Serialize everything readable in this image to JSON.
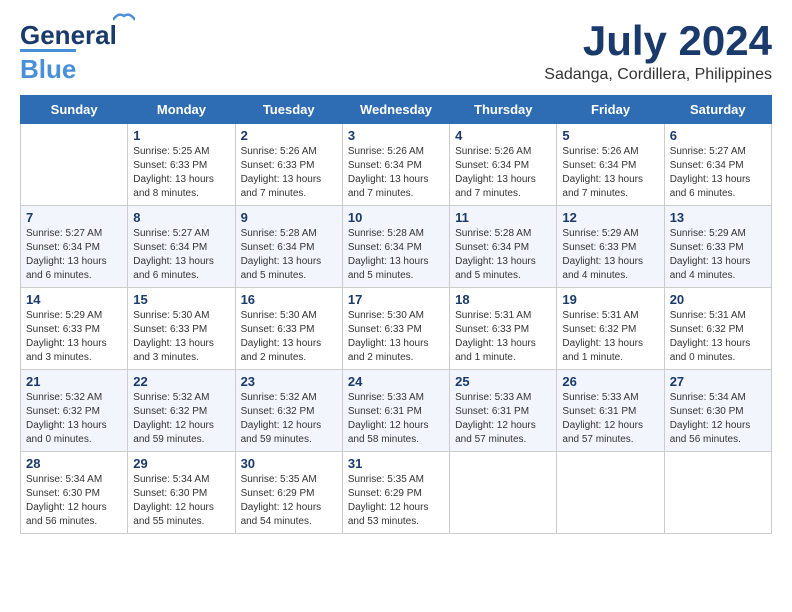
{
  "header": {
    "logo_general": "General",
    "logo_blue": "Blue",
    "month": "July 2024",
    "location": "Sadanga, Cordillera, Philippines"
  },
  "calendar": {
    "days_of_week": [
      "Sunday",
      "Monday",
      "Tuesday",
      "Wednesday",
      "Thursday",
      "Friday",
      "Saturday"
    ],
    "weeks": [
      [
        {
          "day": "",
          "info": ""
        },
        {
          "day": "1",
          "info": "Sunrise: 5:25 AM\nSunset: 6:33 PM\nDaylight: 13 hours\nand 8 minutes."
        },
        {
          "day": "2",
          "info": "Sunrise: 5:26 AM\nSunset: 6:33 PM\nDaylight: 13 hours\nand 7 minutes."
        },
        {
          "day": "3",
          "info": "Sunrise: 5:26 AM\nSunset: 6:34 PM\nDaylight: 13 hours\nand 7 minutes."
        },
        {
          "day": "4",
          "info": "Sunrise: 5:26 AM\nSunset: 6:34 PM\nDaylight: 13 hours\nand 7 minutes."
        },
        {
          "day": "5",
          "info": "Sunrise: 5:26 AM\nSunset: 6:34 PM\nDaylight: 13 hours\nand 7 minutes."
        },
        {
          "day": "6",
          "info": "Sunrise: 5:27 AM\nSunset: 6:34 PM\nDaylight: 13 hours\nand 6 minutes."
        }
      ],
      [
        {
          "day": "7",
          "info": "Sunrise: 5:27 AM\nSunset: 6:34 PM\nDaylight: 13 hours\nand 6 minutes."
        },
        {
          "day": "8",
          "info": "Sunrise: 5:27 AM\nSunset: 6:34 PM\nDaylight: 13 hours\nand 6 minutes."
        },
        {
          "day": "9",
          "info": "Sunrise: 5:28 AM\nSunset: 6:34 PM\nDaylight: 13 hours\nand 5 minutes."
        },
        {
          "day": "10",
          "info": "Sunrise: 5:28 AM\nSunset: 6:34 PM\nDaylight: 13 hours\nand 5 minutes."
        },
        {
          "day": "11",
          "info": "Sunrise: 5:28 AM\nSunset: 6:34 PM\nDaylight: 13 hours\nand 5 minutes."
        },
        {
          "day": "12",
          "info": "Sunrise: 5:29 AM\nSunset: 6:33 PM\nDaylight: 13 hours\nand 4 minutes."
        },
        {
          "day": "13",
          "info": "Sunrise: 5:29 AM\nSunset: 6:33 PM\nDaylight: 13 hours\nand 4 minutes."
        }
      ],
      [
        {
          "day": "14",
          "info": "Sunrise: 5:29 AM\nSunset: 6:33 PM\nDaylight: 13 hours\nand 3 minutes."
        },
        {
          "day": "15",
          "info": "Sunrise: 5:30 AM\nSunset: 6:33 PM\nDaylight: 13 hours\nand 3 minutes."
        },
        {
          "day": "16",
          "info": "Sunrise: 5:30 AM\nSunset: 6:33 PM\nDaylight: 13 hours\nand 2 minutes."
        },
        {
          "day": "17",
          "info": "Sunrise: 5:30 AM\nSunset: 6:33 PM\nDaylight: 13 hours\nand 2 minutes."
        },
        {
          "day": "18",
          "info": "Sunrise: 5:31 AM\nSunset: 6:33 PM\nDaylight: 13 hours\nand 1 minute."
        },
        {
          "day": "19",
          "info": "Sunrise: 5:31 AM\nSunset: 6:32 PM\nDaylight: 13 hours\nand 1 minute."
        },
        {
          "day": "20",
          "info": "Sunrise: 5:31 AM\nSunset: 6:32 PM\nDaylight: 13 hours\nand 0 minutes."
        }
      ],
      [
        {
          "day": "21",
          "info": "Sunrise: 5:32 AM\nSunset: 6:32 PM\nDaylight: 13 hours\nand 0 minutes."
        },
        {
          "day": "22",
          "info": "Sunrise: 5:32 AM\nSunset: 6:32 PM\nDaylight: 12 hours\nand 59 minutes."
        },
        {
          "day": "23",
          "info": "Sunrise: 5:32 AM\nSunset: 6:32 PM\nDaylight: 12 hours\nand 59 minutes."
        },
        {
          "day": "24",
          "info": "Sunrise: 5:33 AM\nSunset: 6:31 PM\nDaylight: 12 hours\nand 58 minutes."
        },
        {
          "day": "25",
          "info": "Sunrise: 5:33 AM\nSunset: 6:31 PM\nDaylight: 12 hours\nand 57 minutes."
        },
        {
          "day": "26",
          "info": "Sunrise: 5:33 AM\nSunset: 6:31 PM\nDaylight: 12 hours\nand 57 minutes."
        },
        {
          "day": "27",
          "info": "Sunrise: 5:34 AM\nSunset: 6:30 PM\nDaylight: 12 hours\nand 56 minutes."
        }
      ],
      [
        {
          "day": "28",
          "info": "Sunrise: 5:34 AM\nSunset: 6:30 PM\nDaylight: 12 hours\nand 56 minutes."
        },
        {
          "day": "29",
          "info": "Sunrise: 5:34 AM\nSunset: 6:30 PM\nDaylight: 12 hours\nand 55 minutes."
        },
        {
          "day": "30",
          "info": "Sunrise: 5:35 AM\nSunset: 6:29 PM\nDaylight: 12 hours\nand 54 minutes."
        },
        {
          "day": "31",
          "info": "Sunrise: 5:35 AM\nSunset: 6:29 PM\nDaylight: 12 hours\nand 53 minutes."
        },
        {
          "day": "",
          "info": ""
        },
        {
          "day": "",
          "info": ""
        },
        {
          "day": "",
          "info": ""
        }
      ]
    ]
  }
}
